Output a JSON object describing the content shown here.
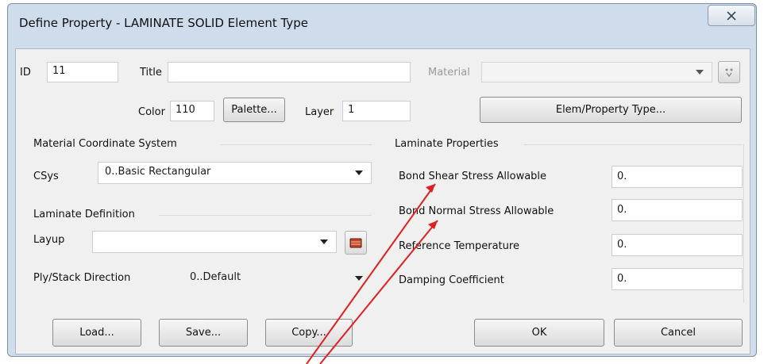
{
  "window": {
    "title": "Define Property - LAMINATE SOLID Element Type"
  },
  "header": {
    "id_label": "ID",
    "id_value": "11",
    "title_label": "Title",
    "title_value": "",
    "material_label": "Material",
    "material_value": "",
    "color_label": "Color",
    "color_value": "110",
    "palette_button": "Palette...",
    "layer_label": "Layer",
    "layer_value": "1",
    "elem_property_type_button": "Elem/Property Type..."
  },
  "material_coordinate_system": {
    "heading": "Material Coordinate System",
    "csys_label": "CSys",
    "csys_value": "0..Basic Rectangular"
  },
  "laminate_definition": {
    "heading": "Laminate Definition",
    "layup_label": "Layup",
    "layup_value": "",
    "ply_stack_label": "Ply/Stack Direction",
    "ply_stack_value": "0..Default"
  },
  "laminate_properties": {
    "heading": "Laminate Properties",
    "rows": [
      {
        "label": "Bond Shear Stress Allowable",
        "value": "0."
      },
      {
        "label": "Bond Normal Stress Allowable",
        "value": "0."
      },
      {
        "label": "Reference Temperature",
        "value": "0."
      },
      {
        "label": "Damping Coefficient",
        "value": "0."
      }
    ]
  },
  "footer": {
    "load_button": "Load...",
    "save_button": "Save...",
    "copy_button": "Copy...",
    "ok_button": "OK",
    "cancel_button": "Cancel"
  },
  "icons": {
    "close": "close-icon",
    "material_picker": "pick-icon",
    "layup_editor": "layup-icon"
  },
  "colors": {
    "annotation_arrow": "#e02020",
    "frame": "#cfdcec"
  }
}
